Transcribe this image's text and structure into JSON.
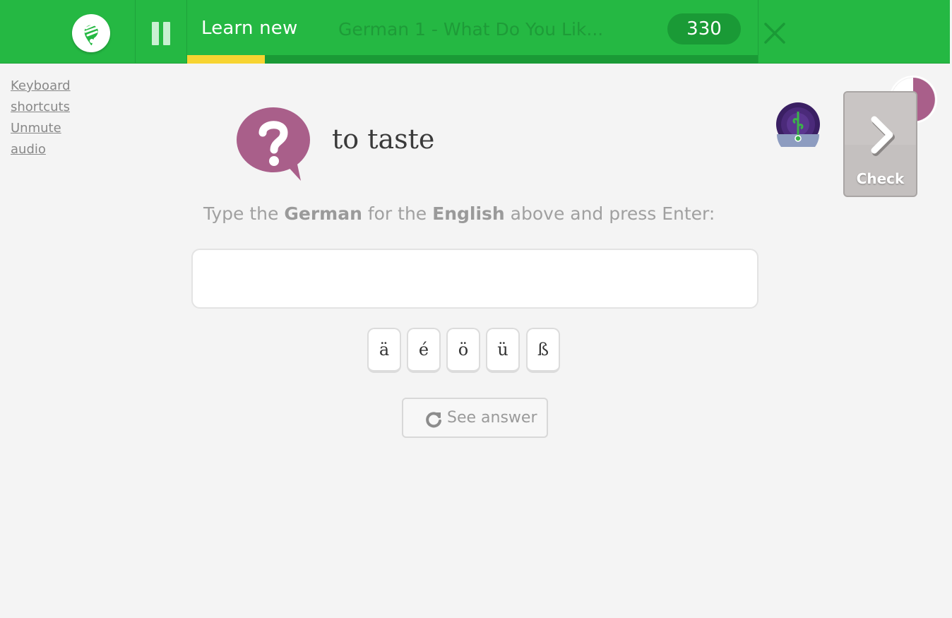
{
  "header": {
    "logo_icon": "memrise-logo-icon",
    "pause_icon": "pause-icon",
    "mode_title": "Learn new",
    "course_title": "German 1 - What Do You Lik...",
    "points": "330",
    "close_icon": "close-icon",
    "session_progress": 0.136,
    "colors": {
      "bar": "#25b843",
      "progress": "#f7d431"
    }
  },
  "sidebar": {
    "links": [
      {
        "label": "Keyboard"
      },
      {
        "label": "shortcuts"
      },
      {
        "label": "Unmute"
      },
      {
        "label": "audio"
      }
    ]
  },
  "question": {
    "icon": "question-bubble-icon",
    "prompt": "to taste",
    "instruction": {
      "part1": "Type the ",
      "target_lang": "German",
      "part2": " for the ",
      "source_lang": "English",
      "part3": " above and press Enter:"
    },
    "answer_value": "",
    "special_chars": [
      "ä",
      "é",
      "ö",
      "ü",
      "ß"
    ],
    "see_answer_label": "See answer",
    "see_answer_icon": "refresh-icon"
  },
  "side": {
    "timer_icon": "timer-pie-icon",
    "avatar_icon": "plant-level-avatar-icon",
    "check_label": "Check",
    "check_icon": "chevron-right-icon"
  }
}
